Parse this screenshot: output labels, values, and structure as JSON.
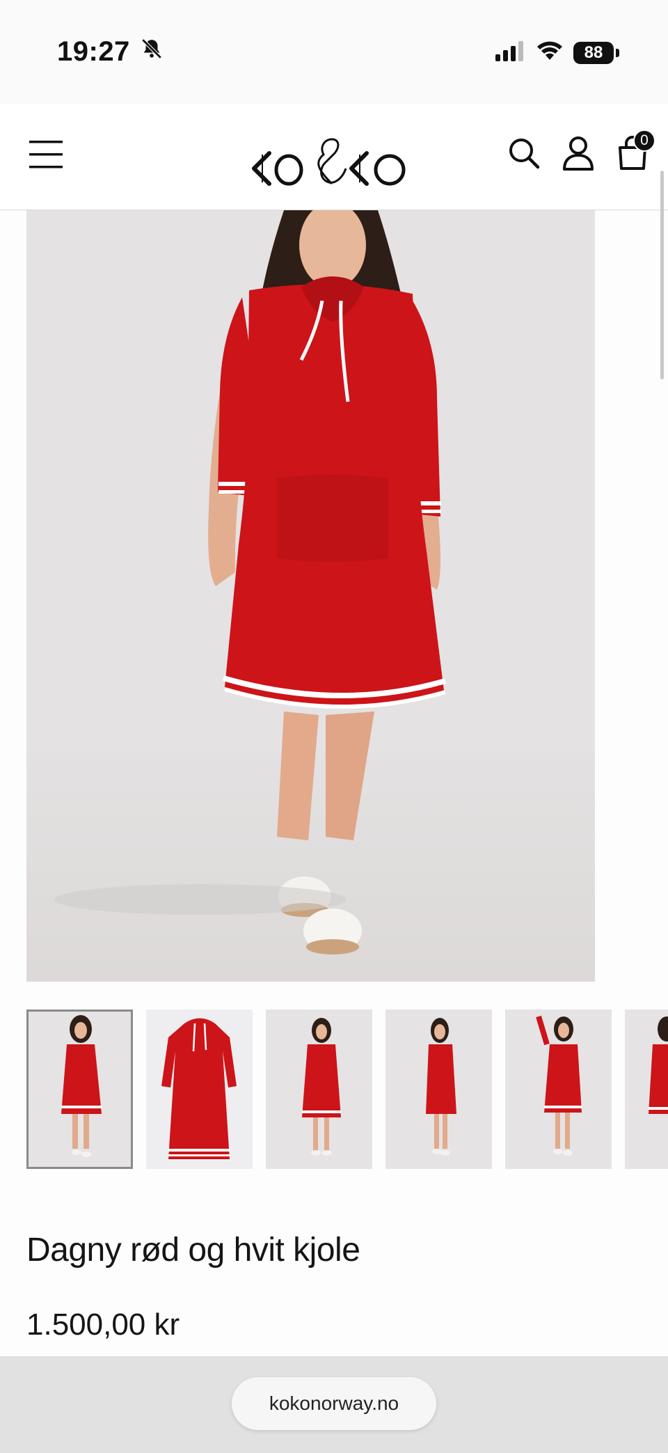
{
  "status_bar": {
    "time": "19:27",
    "battery": "88",
    "icons": [
      "bell-slash-icon",
      "signal-icon",
      "wifi-icon",
      "battery-icon"
    ]
  },
  "header": {
    "logo_text": "KO&KO",
    "cart_count": "0",
    "icons": [
      "menu-icon",
      "search-icon",
      "account-icon",
      "cart-icon"
    ]
  },
  "gallery": {
    "thumbnails": [
      {
        "label": "thumb-1",
        "active": true
      },
      {
        "label": "thumb-2",
        "active": false
      },
      {
        "label": "thumb-3",
        "active": false
      },
      {
        "label": "thumb-4",
        "active": false
      },
      {
        "label": "thumb-5",
        "active": false
      },
      {
        "label": "thumb-6",
        "active": false
      }
    ]
  },
  "product": {
    "title": "Dagny rød og hvit kjole",
    "price": "1.500,00 kr"
  },
  "browser": {
    "url": "kokonorway.no"
  },
  "colors": {
    "dress_red": "#cc1419",
    "stripe_white": "#ffffff",
    "background": "#e4e2e3"
  }
}
